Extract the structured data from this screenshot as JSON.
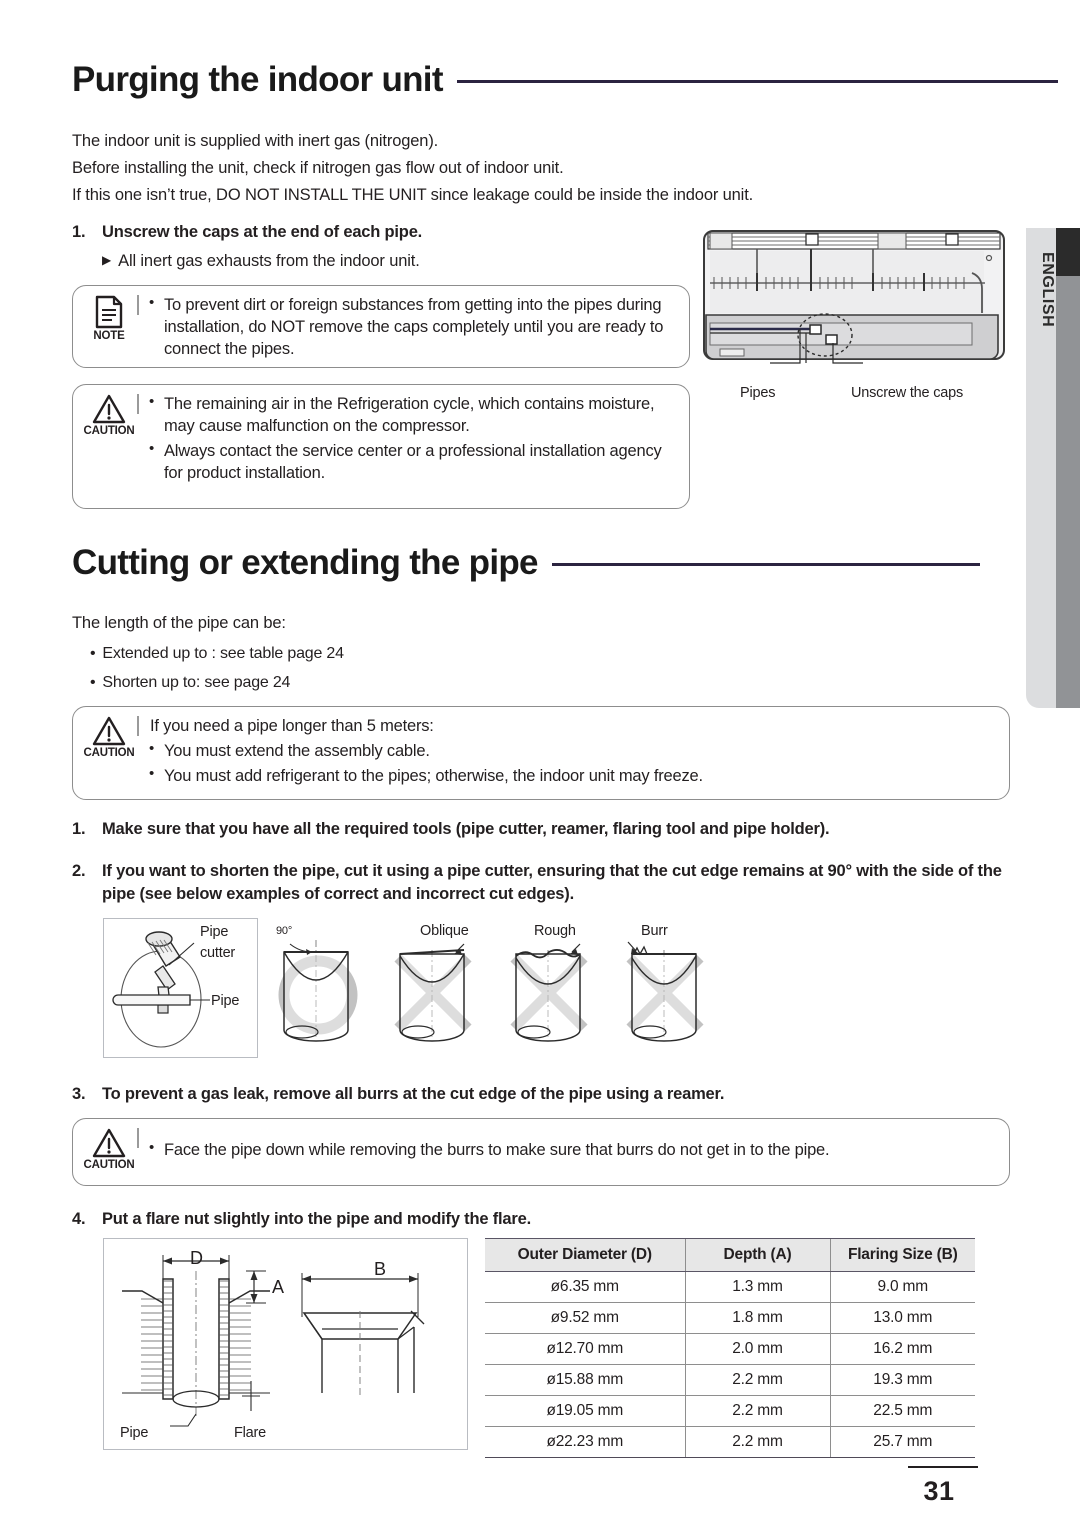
{
  "page": {
    "number": "31",
    "language_tab": "ENGLISH"
  },
  "section1": {
    "title": "Purging the indoor unit",
    "intro": [
      "The indoor unit is supplied with inert gas  (nitrogen).",
      "Before installing the unit, check if nitrogen gas flow out of indoor unit.",
      "If this one isn’t true, DO NOT INSTALL THE UNIT since leakage could be inside the indoor unit."
    ],
    "step1": {
      "number": "1.",
      "text": "Unscrew the caps at the end of each pipe."
    },
    "step1_sub": "All inert gas exhausts from the indoor unit.",
    "note_box": {
      "icon_caption": "NOTE",
      "items": [
        "To prevent dirt or foreign substances from getting into the pipes during installation, do NOT remove the caps completely until you are ready to connect the pipes."
      ]
    },
    "caution_box": {
      "icon_caption": "CAUTION",
      "items": [
        "The remaining air in the Refrigeration cycle, which contains moisture, may cause malfunction on the compressor.",
        "Always contact the service center or a professional installation agency for product installation."
      ]
    },
    "figure": {
      "label_pipes": "Pipes",
      "label_unscrew": "Unscrew the caps"
    }
  },
  "section2": {
    "title": "Cutting or extending the pipe",
    "lead": "The length of the pipe can be:",
    "bullets": [
      "Extended up to : see table page 24",
      "Shorten up to: see page 24"
    ],
    "caution_box": {
      "icon_caption": "CAUTION",
      "heading": "If you need a pipe longer than 5 meters:",
      "items": [
        "You must extend the assembly cable.",
        "You must add refrigerant to the pipes; otherwise, the indoor unit may freeze."
      ]
    },
    "step1": {
      "number": "1.",
      "text": "Make sure that you have all the required tools (pipe cutter, reamer, flaring tool and pipe holder)."
    },
    "step2": {
      "number": "2.",
      "line1": "If you want to shorten the pipe, cut it using a pipe cutter, ensuring that the cut edge remains at 90° with the side of the",
      "line2": "pipe (see below examples of correct and incorrect cut edges)."
    },
    "cutter_figure": {
      "label_pipe_cutter_l1": "Pipe",
      "label_pipe_cutter_l2": "cutter",
      "label_pipe": "Pipe"
    },
    "cut_examples": [
      {
        "label": "90°",
        "mark": "circle"
      },
      {
        "label": "Oblique",
        "mark": "cross"
      },
      {
        "label": "Rough",
        "mark": "cross"
      },
      {
        "label": "Burr",
        "mark": "cross"
      }
    ],
    "step3": {
      "number": "3.",
      "text": "To prevent a gas leak, remove all burrs at the cut edge of the pipe using a reamer."
    },
    "caution_box2": {
      "icon_caption": "CAUTION",
      "items": [
        "Face the pipe down while removing the burrs to make sure that burrs do not get in to the pipe."
      ]
    },
    "step4": {
      "number": "4.",
      "text": "Put a flare nut slightly into the pipe and modify the flare."
    },
    "flare_figure": {
      "dim_d": "D",
      "dim_a": "A",
      "dim_b": "B",
      "label_pipe": "Pipe",
      "label_flare": "Flare"
    },
    "spec_table": {
      "headers": [
        "Outer Diameter (D)",
        "Depth (A)",
        "Flaring Size (B)"
      ],
      "rows": [
        [
          "ø6.35 mm",
          "1.3 mm",
          "9.0 mm"
        ],
        [
          "ø9.52 mm",
          "1.8 mm",
          "13.0 mm"
        ],
        [
          "ø12.70 mm",
          "2.0 mm",
          "16.2 mm"
        ],
        [
          "ø15.88 mm",
          "2.2 mm",
          "19.3 mm"
        ],
        [
          "ø19.05 mm",
          "2.2 mm",
          "22.5 mm"
        ],
        [
          "ø22.23 mm",
          "2.2 mm",
          "25.7 mm"
        ]
      ]
    }
  },
  "colors": {
    "rule": "#2b2340",
    "box_border": "#8d8d8d",
    "table_header_bg": "#e7e7e7",
    "side_tab": "#dcdddf",
    "side_bar": "#919396"
  }
}
